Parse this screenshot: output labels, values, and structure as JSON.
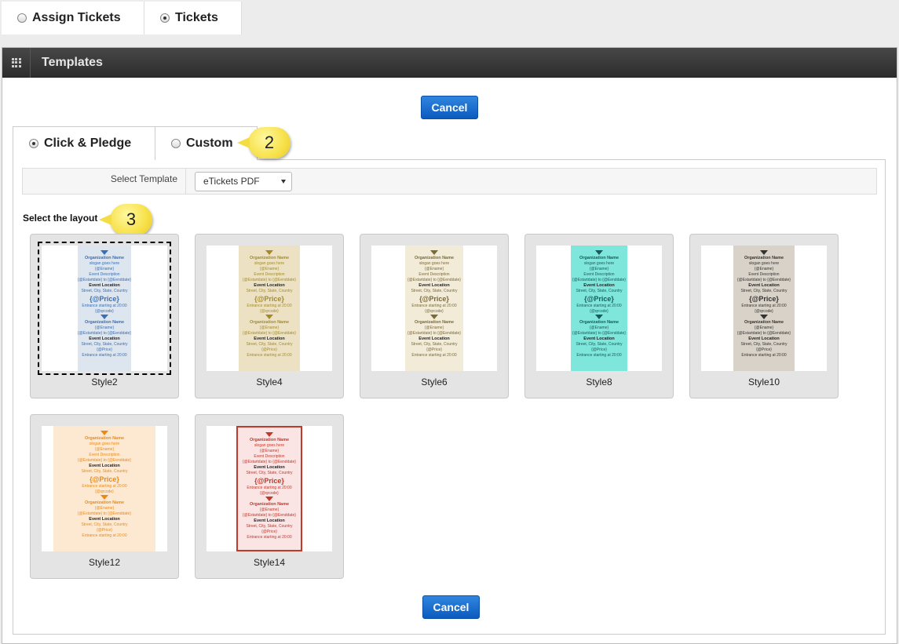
{
  "top_tabs": [
    {
      "label": "Assign Tickets",
      "selected": false
    },
    {
      "label": "Tickets",
      "selected": true
    }
  ],
  "panel": {
    "title": "Templates"
  },
  "buttons": {
    "cancel_top": "Cancel",
    "cancel_bottom": "Cancel"
  },
  "inner_tabs": [
    {
      "label": "Click & Pledge",
      "selected": true
    },
    {
      "label": "Custom",
      "selected": false
    }
  ],
  "callouts": {
    "custom": "2",
    "layout": "3"
  },
  "select_template": {
    "label": "Select Template",
    "value": "eTickets PDF"
  },
  "layout_label": "Select the layout",
  "ticket_text": {
    "org": "Organization Name",
    "tagline": "slogan goes here",
    "ename": "{@Ename}",
    "desc": "Event Description",
    "dates": "{@Estartdate} to {@Eenddate}",
    "loc_h": "Event Location",
    "loc": "Street, City, State, Country",
    "price": "{@Price}",
    "entrance": "Entrance starting at 20:00",
    "qrcode": "{@qrcode}"
  },
  "layouts": [
    {
      "name": "Style2",
      "selected": true,
      "accent": "#3a6fb5",
      "bg": "#dde5ee"
    },
    {
      "name": "Style4",
      "selected": false,
      "accent": "#a38b2c",
      "bg": "#ece2c3"
    },
    {
      "name": "Style6",
      "selected": false,
      "accent": "#7a6a3a",
      "bg": "#f2ebd8"
    },
    {
      "name": "Style8",
      "selected": false,
      "accent": "#1b5a5a",
      "bg": "#7fe6dc"
    },
    {
      "name": "Style10",
      "selected": false,
      "accent": "#333333",
      "bg": "#d9d2c8"
    },
    {
      "name": "Style12",
      "selected": false,
      "accent": "#e88a1a",
      "bg": "#fde9d2"
    },
    {
      "name": "Style14",
      "selected": false,
      "accent": "#c0392b",
      "bg": "#fbe4e4"
    }
  ]
}
